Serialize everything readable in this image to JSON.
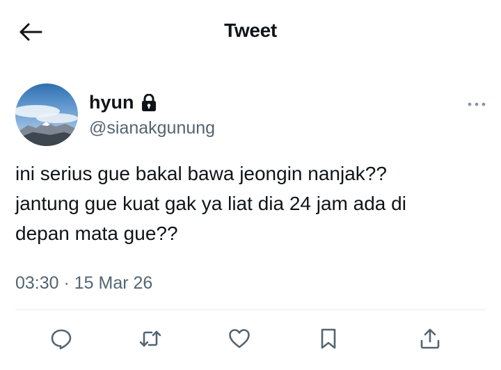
{
  "header": {
    "title": "Tweet",
    "back_icon": "arrow-left-icon"
  },
  "tweet": {
    "display_name": "hyun",
    "protected_icon": "lock-icon",
    "handle": "@sianakgunung",
    "text": "ini serius gue bakal bawa jeongin nanjak??\njantung gue kuat gak ya liat dia 24 jam ada di\ndepan mata gue??",
    "timestamp": "03:30 · 15 Mar 26",
    "more_icon": "more-horizontal-icon"
  },
  "actions": [
    {
      "name": "reply",
      "icon": "reply-icon"
    },
    {
      "name": "retweet",
      "icon": "retweet-icon"
    },
    {
      "name": "like",
      "icon": "heart-icon"
    },
    {
      "name": "bookmark",
      "icon": "bookmark-icon"
    },
    {
      "name": "share",
      "icon": "share-icon"
    }
  ],
  "colors": {
    "text": "#0f1419",
    "secondary": "#536471",
    "divider": "#e6ecf0"
  }
}
